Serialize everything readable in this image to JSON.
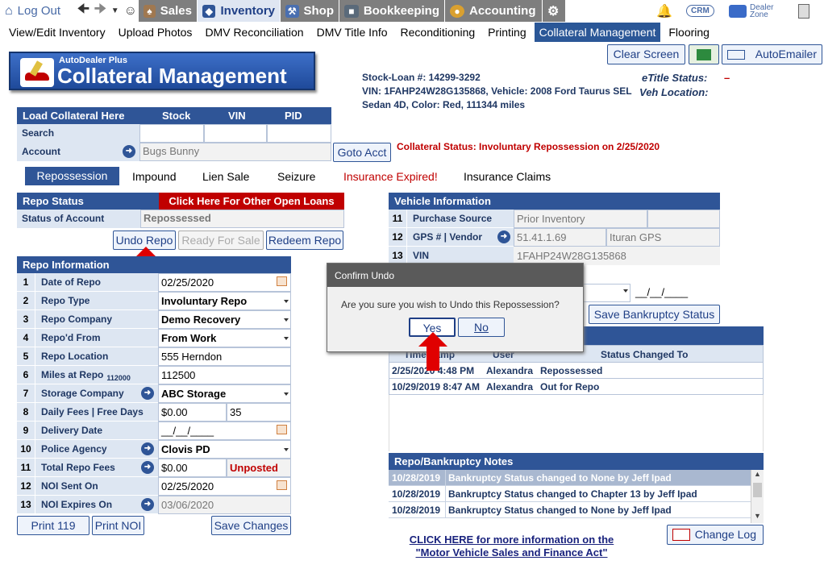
{
  "topbar": {
    "logout": "Log Out",
    "sales": "Sales",
    "inventory": "Inventory",
    "shop": "Shop",
    "bookkeeping": "Bookkeeping",
    "accounting": "Accounting",
    "crm": "CRM",
    "dealer_zone_1": "Dealer",
    "dealer_zone_2": "Zone"
  },
  "subnav": [
    "View/Edit Inventory",
    "Upload Photos",
    "DMV Reconciliation",
    "DMV Title Info",
    "Reconditioning",
    "Printing",
    "Collateral Management",
    "Flooring"
  ],
  "logo": {
    "small": "AutoDealer Plus",
    "title": "Collateral Management"
  },
  "header_buttons": {
    "clear": "Clear Screen",
    "autoemailer": "AutoEmailer"
  },
  "vehicle_summary": {
    "line1": "Stock-Loan #:  14299-3292",
    "line2": "VIN:  1FAHP24W28G135868, Vehicle:  2008 Ford Taurus SEL",
    "line3": "Sedan 4D, Color: Red, 111344 miles",
    "etitle_label": "eTitle Status:",
    "etitle_value": "–",
    "vehloc_label": "Veh Location:"
  },
  "load": {
    "head": "Load Collateral Here",
    "stock": "Stock",
    "vin": "VIN",
    "pid": "PID",
    "search": "Search",
    "account": "Account",
    "account_value": "Bugs Bunny",
    "goto": "Goto Acct"
  },
  "collateral_status": "Collateral Status: Involuntary Repossession on 2/25/2020",
  "tabs": [
    "Repossession",
    "Impound",
    "Lien Sale",
    "Seizure",
    "Insurance Expired!",
    "Insurance Claims"
  ],
  "repo_status": {
    "head": "Repo Status",
    "other_loans": "Click Here For Other Open Loans",
    "status_label": "Status of Account",
    "status_value": "Repossessed",
    "undo": "Undo Repo",
    "ready": "Ready For Sale",
    "redeem": "Redeem Repo"
  },
  "repo_info": {
    "head": "Repo Information",
    "rows": [
      {
        "n": "1",
        "label": "Date of Repo",
        "value": "02/25/2020"
      },
      {
        "n": "2",
        "label": "Repo Type",
        "value": "Involuntary Repo"
      },
      {
        "n": "3",
        "label": "Repo Company",
        "value": "Demo Recovery"
      },
      {
        "n": "4",
        "label": "Repo'd From",
        "value": "From Work"
      },
      {
        "n": "5",
        "label": "Repo Location",
        "value": "555 Herndon"
      },
      {
        "n": "6",
        "label": "Miles at Repo",
        "sub": "112000",
        "value": "112500"
      },
      {
        "n": "7",
        "label": "Storage Company",
        "value": "ABC Storage"
      },
      {
        "n": "8",
        "label": "Daily Fees | Free Days",
        "value": "$0.00",
        "value2": "35"
      },
      {
        "n": "9",
        "label": "Delivery Date",
        "value": "__/__/____"
      },
      {
        "n": "10",
        "label": "Police Agency",
        "value": "Clovis PD"
      },
      {
        "n": "11",
        "label": "Total Repo Fees",
        "value": "$0.00",
        "value2": "Unposted"
      },
      {
        "n": "12",
        "label": "NOI Sent On",
        "value": "02/25/2020"
      },
      {
        "n": "13",
        "label": "NOI Expires On",
        "value": "03/06/2020"
      }
    ],
    "print119": "Print 119",
    "printnoi": "Print NOI",
    "save": "Save Changes"
  },
  "vehicle_info": {
    "head": "Vehicle Information",
    "rows": [
      {
        "n": "11",
        "label": "Purchase Source",
        "value": "Prior Inventory"
      },
      {
        "n": "12",
        "label": "GPS # | Vendor",
        "value": "51.41.1.69",
        "value2": "Ituran GPS"
      },
      {
        "n": "13",
        "label": "VIN",
        "value": "1FAHP24W28G135868"
      }
    ],
    "bk_date": "__/__/____",
    "save_bk": "Save Bankruptcy Status"
  },
  "history": {
    "cols": [
      "Timestamp",
      "User",
      "Status Changed To"
    ],
    "rows": [
      {
        "ts": "2/25/2020 4:48 PM",
        "user": "Alexandra",
        "status": "Repossessed"
      },
      {
        "ts": "10/29/2019 8:47 AM",
        "user": "Alexandra",
        "status": "Out for Repo"
      }
    ]
  },
  "notes": {
    "head": "Repo/Bankruptcy Notes",
    "rows": [
      {
        "date": "10/28/2019",
        "text": "Bankruptcy Status changed to None by Jeff Ipad"
      },
      {
        "date": "10/28/2019",
        "text": "Bankruptcy Status changed to Chapter 13 by Jeff Ipad"
      },
      {
        "date": "10/28/2019",
        "text": "Bankruptcy Status changed to None by Jeff Ipad"
      }
    ]
  },
  "footer": {
    "link1": "CLICK HERE for more information on the",
    "link2": "\"Motor Vehicle Sales and Finance Act\"",
    "changelog": "Change Log"
  },
  "dialog": {
    "title": "Confirm Undo",
    "message": "Are you sure you wish to Undo this Repossession?",
    "yes": "Yes",
    "no": "No"
  },
  "colors": {
    "brand_blue": "#2f5597",
    "alert_red": "#c00000"
  }
}
